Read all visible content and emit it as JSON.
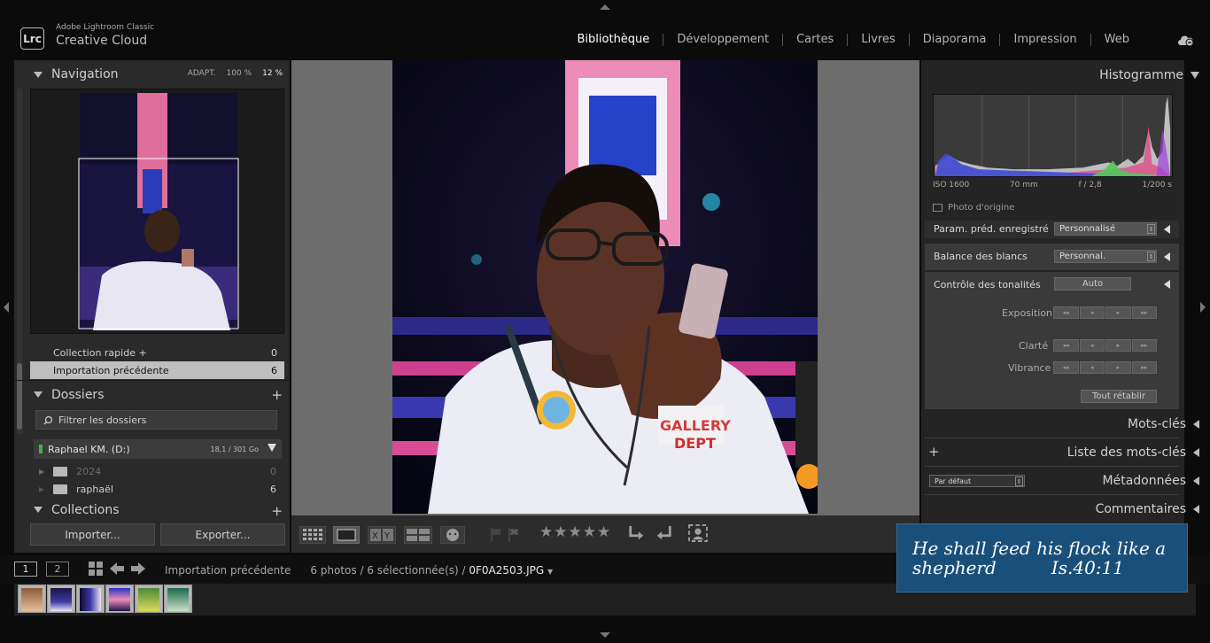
{
  "app": {
    "product_line": "Adobe Lightroom Classic",
    "name": "Creative Cloud",
    "logo_text": "Lrc"
  },
  "modules": [
    "Bibliothèque",
    "Développement",
    "Cartes",
    "Livres",
    "Diaporama",
    "Impression",
    "Web"
  ],
  "active_module": "Bibliothèque",
  "navigator": {
    "title": "Navigation",
    "fit_label": "ADAPT.",
    "fill_label": "100 %",
    "zoom_label": "12 %"
  },
  "collections_quick": [
    {
      "label": "Collection rapide +",
      "count": "0",
      "selected": false
    },
    {
      "label": "Importation précédente",
      "count": "6",
      "selected": true
    }
  ],
  "folders": {
    "title": "Dossiers",
    "filter_placeholder": "Filtrer les dossiers",
    "volume": {
      "name": "Raphael KM. (D:)",
      "space": "18,1 / 301 Go"
    },
    "items": [
      {
        "name": "2024",
        "count": "0",
        "dim": true
      },
      {
        "name": "raphaël",
        "count": "6",
        "dim": false
      }
    ]
  },
  "collections_title": "Collections",
  "buttons": {
    "import": "Importer...",
    "export": "Exporter..."
  },
  "toolbar": {
    "stars": "★★★★★"
  },
  "right": {
    "histogram_title": "Histogramme",
    "exif": {
      "iso": "ISO 1600",
      "focal": "70 mm",
      "aperture": "f / 2,8",
      "shutter": "1/200 s"
    },
    "original_photo": "Photo d'origine",
    "preset_label": "Param. préd. enregistré",
    "preset_value": "Personnalisé",
    "wb_label": "Balance des blancs",
    "wb_value": "Personnal.",
    "tone_label": "Contrôle des tonalités",
    "auto": "Auto",
    "exposure": "Exposition",
    "clarity": "Clarté",
    "vibrance": "Vibrance",
    "reset_all": "Tout rétablir",
    "keywords": "Mots-clés",
    "keyword_list": "Liste des mots-clés",
    "metadata_preset": "Par défaut",
    "metadata": "Métadonnées",
    "comments": "Commentaires"
  },
  "filmstrip": {
    "page1": "1",
    "page2": "2",
    "source": "Importation précédente",
    "count": "6 photos / 6 sélectionnée(s) /",
    "filename": "0F0A2503.JPG"
  },
  "verse": {
    "line1": "He shall feed his flock like a",
    "line2": "shepherd",
    "ref": "Is.40:11"
  }
}
